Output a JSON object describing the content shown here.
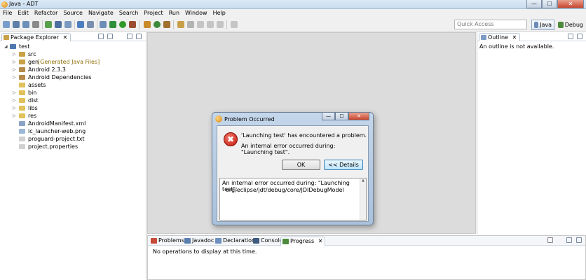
{
  "window": {
    "title": "Java - ADT",
    "controls": {
      "minimize": "—",
      "maximize": "☐",
      "close": "✕"
    }
  },
  "menu": [
    "File",
    "Edit",
    "Refactor",
    "Source",
    "Navigate",
    "Search",
    "Project",
    "Run",
    "Window",
    "Help"
  ],
  "toolbar": {
    "quick_access_placeholder": "Quick Access",
    "perspectives": [
      {
        "label": "Java",
        "icon": "java-perspective-icon",
        "active": true
      },
      {
        "label": "Debug",
        "icon": "debug-perspective-icon",
        "active": false
      }
    ]
  },
  "package_explorer": {
    "title": "Package Explorer",
    "close": "✕",
    "tree": [
      {
        "label": "test",
        "depth": 0,
        "expanded": true,
        "icon": "project-icon"
      },
      {
        "label": "src",
        "depth": 1,
        "icon": "source-folder-icon"
      },
      {
        "label": "gen",
        "suffix": "[Generated Java Files]",
        "depth": 1,
        "icon": "source-folder-icon"
      },
      {
        "label": "Android 2.3.3",
        "depth": 1,
        "icon": "library-icon"
      },
      {
        "label": "Android Dependencies",
        "depth": 1,
        "icon": "library-icon"
      },
      {
        "label": "assets",
        "depth": 1,
        "icon": "folder-icon",
        "no_arrow": true
      },
      {
        "label": "bin",
        "depth": 1,
        "icon": "folder-icon"
      },
      {
        "label": "dist",
        "depth": 1,
        "icon": "folder-icon"
      },
      {
        "label": "libs",
        "depth": 1,
        "icon": "folder-icon"
      },
      {
        "label": "res",
        "depth": 1,
        "icon": "folder-icon"
      },
      {
        "label": "AndroidManifest.xml",
        "depth": 1,
        "icon": "xml-file-icon",
        "no_arrow": true
      },
      {
        "label": "ic_launcher-web.png",
        "depth": 1,
        "icon": "image-file-icon",
        "no_arrow": true
      },
      {
        "label": "proguard-project.txt",
        "depth": 1,
        "icon": "text-file-icon",
        "no_arrow": true
      },
      {
        "label": "project.properties",
        "depth": 1,
        "icon": "text-file-icon",
        "no_arrow": true
      }
    ]
  },
  "outline": {
    "title": "Outline",
    "close": "✕",
    "message": "An outline is not available."
  },
  "bottom_panel": {
    "tabs": [
      {
        "label": "Problems",
        "icon": "problems-icon"
      },
      {
        "label": "Javadoc",
        "icon": "javadoc-icon"
      },
      {
        "label": "Declaration",
        "icon": "declaration-icon"
      },
      {
        "label": "Console",
        "icon": "console-icon"
      },
      {
        "label": "Progress",
        "icon": "progress-icon",
        "active": true
      }
    ],
    "close": "✕",
    "message": "No operations to display at this time."
  },
  "dialog": {
    "title": "Problem Occurred",
    "message": "'Launching test' has encountered a problem.",
    "detail": "An internal error occurred during: \"Launching test\".",
    "ok_label": "OK",
    "details_label": "<< Details",
    "details_text_line1": "An internal error occurred during: \"Launching test\".",
    "details_text_line2": "org/eclipse/jdt/debug/core/JDIDebugModel",
    "error_glyph": "✖",
    "controls": {
      "minimize": "—",
      "maximize": "☐",
      "close": "✕"
    }
  }
}
